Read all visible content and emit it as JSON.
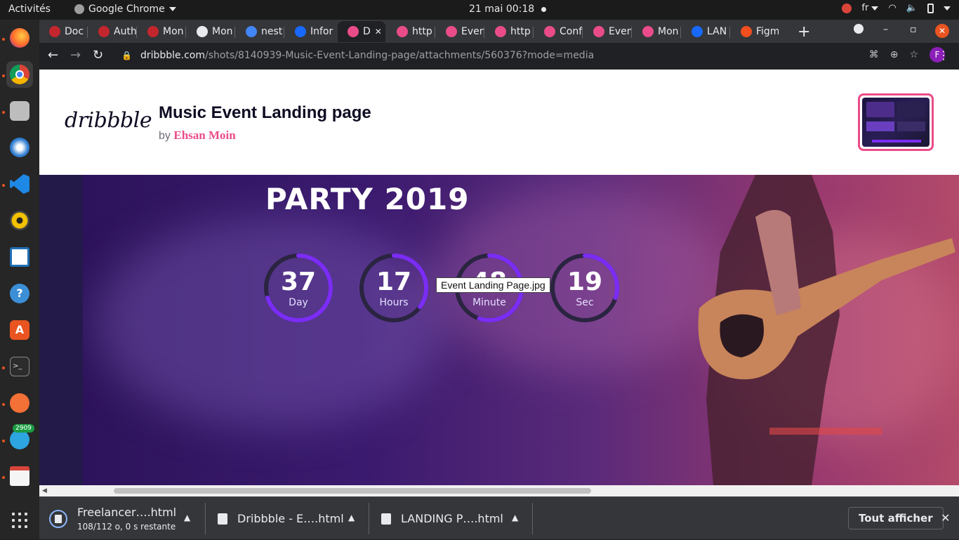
{
  "topbar": {
    "activities": "Activités",
    "app_name": "Google Chrome",
    "clock": "21 mai  00:18",
    "lang": "fr"
  },
  "dock": {
    "items": [
      "firefox-icon",
      "chrome-icon",
      "files-icon",
      "thunderbird-icon",
      "vscode-icon",
      "rhythmbox-icon",
      "writer-icon",
      "help-icon",
      "software-icon",
      "terminal-icon",
      "postman-icon",
      "telegram-icon",
      "text-editor-icon"
    ],
    "telegram_badge": "2909"
  },
  "tabs": [
    {
      "label": "Doc",
      "color": "#c4262e"
    },
    {
      "label": "Auth",
      "color": "#c4262e"
    },
    {
      "label": "Mon",
      "color": "#c4262e"
    },
    {
      "label": "Mon",
      "color": "#e8eaed"
    },
    {
      "label": "nest",
      "color": "#4285f4"
    },
    {
      "label": "Infor",
      "color": "#1769ff"
    },
    {
      "label": "D",
      "color": "#ea4c89",
      "active": true
    },
    {
      "label": "http",
      "color": "#ea4c89"
    },
    {
      "label": "Even",
      "color": "#ea4c89"
    },
    {
      "label": "http",
      "color": "#ea4c89"
    },
    {
      "label": "Conf",
      "color": "#ea4c89"
    },
    {
      "label": "Even",
      "color": "#ea4c89"
    },
    {
      "label": "Mon",
      "color": "#ea4c89"
    },
    {
      "label": "LAN",
      "color": "#1769ff"
    },
    {
      "label": "Figm",
      "color": "#f24e1e"
    }
  ],
  "address": {
    "host": "dribbble.com",
    "path": "/shots/8140939-Music-Event-Landing-page/attachments/560376?mode=media",
    "profile": "F"
  },
  "shot": {
    "logo": "dribbble",
    "title": "Music Event Landing page",
    "by": "by",
    "author": "Ehsan Moin"
  },
  "hero": {
    "heading": "PARTY 2019",
    "countdown": [
      {
        "value": "37",
        "unit": "Day",
        "progress": 0.7
      },
      {
        "value": "17",
        "unit": "Hours",
        "progress": 0.35
      },
      {
        "value": "48",
        "unit": "Minute",
        "progress": 0.55
      },
      {
        "value": "19",
        "unit": "Sec",
        "progress": 0.3
      }
    ],
    "tooltip": "Event Landing Page.jpg"
  },
  "downloads": {
    "items": [
      {
        "name": "Freelancer….html",
        "status": "108/112 o, 0 s restante"
      },
      {
        "name": "Dribbble - E….html"
      },
      {
        "name": "LANDING P….html"
      }
    ],
    "show_all": "Tout afficher"
  },
  "colors": {
    "accent": "#ea4c89",
    "ring": "#7b2cf5",
    "ring_track": "#2a2440"
  }
}
